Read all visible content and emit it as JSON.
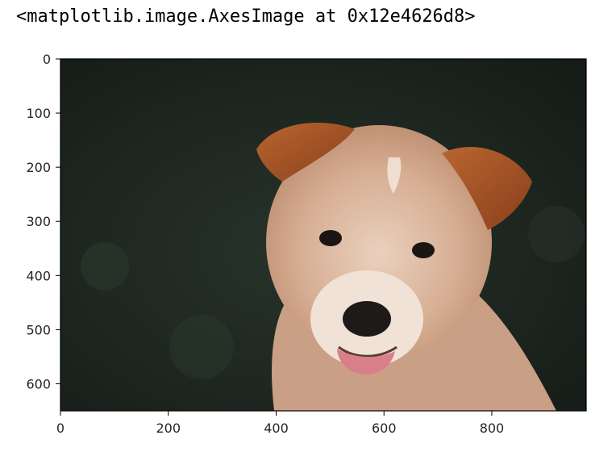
{
  "output_text": "<matplotlib.image.AxesImage at 0x12e4626d8>",
  "chart_data": {
    "type": "image",
    "image_content": "photo of a tan puppy with brown ears on a dark green background",
    "xlim": [
      0,
      975
    ],
    "ylim": [
      650,
      0
    ],
    "x_ticks": [
      0,
      200,
      400,
      600,
      800
    ],
    "y_ticks": [
      0,
      100,
      200,
      300,
      400,
      500,
      600
    ],
    "x_tick_labels": [
      "0",
      "200",
      "400",
      "600",
      "800"
    ],
    "y_tick_labels": [
      "0",
      "100",
      "200",
      "300",
      "400",
      "500",
      "600"
    ]
  },
  "colors": {
    "background_dark": "#1c241f",
    "fur_light": "#d8b39b",
    "ear_brown": "#a8552b",
    "nose": "#1e1a1a",
    "tongue": "#d97f8a"
  }
}
